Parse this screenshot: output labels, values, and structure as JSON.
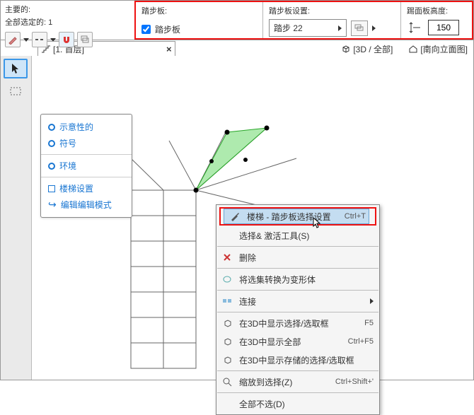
{
  "topbar": {
    "left_label": "主要的:",
    "selection_label": "全部选定的: 1"
  },
  "redbar": {
    "sec1": {
      "title": "踏步板:",
      "checkbox_label": "踏步板",
      "checked": true
    },
    "sec2": {
      "title": "踏步板设置:",
      "dropdown_value": "踏步 22"
    },
    "sec3": {
      "title": "踢面板高度:",
      "value": "150"
    }
  },
  "tabs": {
    "main": "[1. 首层]",
    "view3d": "[3D / 全部]",
    "elev": "[南向立面图]"
  },
  "floatpanel": {
    "items": [
      "示意性的",
      "符号",
      "环境",
      "楼梯设置",
      "编辑编辑模式"
    ]
  },
  "context_menu": {
    "highlight": {
      "label": "楼梯 - 踏步板选择设置",
      "shortcut": "Ctrl+T"
    },
    "items": {
      "activate": "选择& 激活工具(S)",
      "delete": "删除",
      "transform": "将选集转换为变形体",
      "connect": "连接",
      "show3d_sel": "在3D中显示选择/选取框",
      "show3d_sel_sc": "F5",
      "show3d_all": "在3D中显示全部",
      "show3d_all_sc": "Ctrl+F5",
      "show3d_stored": "在3D中显示存储的选择/选取框",
      "zoom": "缩放到选择(Z)",
      "zoom_sc": "Ctrl+Shift+'",
      "deselect": "全部不选(D)"
    }
  }
}
